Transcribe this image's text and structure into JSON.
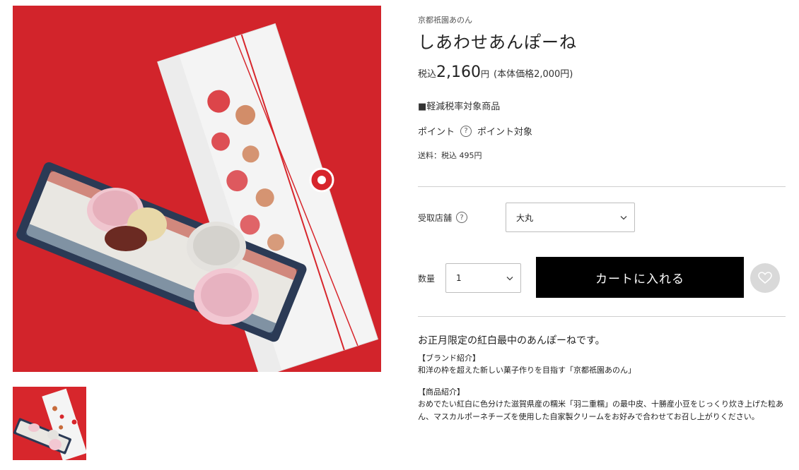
{
  "product": {
    "brand": "京都祇園あのん",
    "title": "しあわせあんぽーね",
    "price_prefix": "税込",
    "price_value": "2,160",
    "price_yen": "円",
    "price_base": "(本体価格2,000円)",
    "tax_note": "■軽減税率対象商品",
    "points_label": "ポイント",
    "points_help": "?",
    "points_value": "ポイント対象",
    "shipping": "送料：税込 495円"
  },
  "options": {
    "store_label": "受取店舗",
    "store_help": "?",
    "store_value": "大丸",
    "qty_label": "数量",
    "qty_value": "1"
  },
  "actions": {
    "cart_label": "カートに入れる"
  },
  "description": {
    "lead": "お正月限定の紅白最中のあんぽーねです。",
    "brand_heading": "【ブランド紹介】",
    "brand_text": "和洋の枠を超えた新しい菓子作りを目指す「京都祇園あのん」",
    "product_heading": "【商品紹介】",
    "product_text": "おめでたい紅白に色分けた滋賀県産の糯米「羽二重糯」の最中皮、十勝産小豆をじっくり炊き上げた粒あん、マスカルポーネチーズを使用した自家製クリームをお好みで合わせてお召し上がりください。"
  },
  "colors": {
    "background_red": "#d7262c",
    "cart_button_bg": "#000000",
    "fav_button_bg": "#d9d9d9"
  },
  "icons": {
    "chevron": "chevron-down-icon",
    "help": "help-circle-icon",
    "favorite": "heart-icon"
  }
}
